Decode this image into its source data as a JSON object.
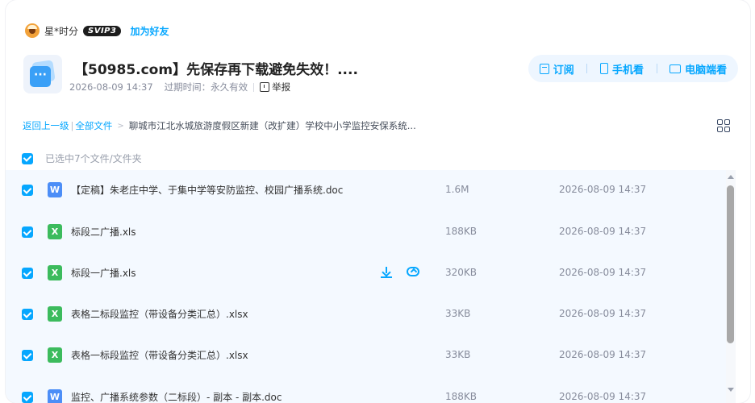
{
  "user": {
    "name": "星*时分",
    "badge": "SVIP3",
    "add_friend": "加为好友"
  },
  "file": {
    "icon_glyph": "···",
    "title": "【50985.com】先保存再下载避免失效！....",
    "date": "2026-08-09 14:37",
    "expire": "过期时间：永久有效",
    "report": "举报"
  },
  "actions": {
    "subscribe": "订阅",
    "mobile": "手机看",
    "pc": "电脑端看"
  },
  "breadcrumb": {
    "back": "返回上一级",
    "all": "全部文件",
    "current": "聊城市江北水城旅游度假区新建（改扩建）学校中小学监控安保系统..."
  },
  "selection": {
    "text": "已选中7个文件/文件夹"
  },
  "files": [
    {
      "type": "W",
      "name": "【定稿】朱老庄中学、于集中学等安防监控、校园广播系统.doc",
      "size": "1.6M",
      "date": "2026-08-09 14:37"
    },
    {
      "type": "X",
      "name": "标段二广播.xls",
      "size": "188KB",
      "date": "2026-08-09 14:37"
    },
    {
      "type": "X",
      "name": "标段一广播.xls",
      "size": "320KB",
      "date": "2026-08-09 14:37"
    },
    {
      "type": "X",
      "name": "表格二标段监控（带设备分类汇总）.xlsx",
      "size": "33KB",
      "date": "2026-08-09 14:37"
    },
    {
      "type": "X",
      "name": "表格一标段监控（带设备分类汇总）.xlsx",
      "size": "33KB",
      "date": "2026-08-09 14:37"
    },
    {
      "type": "W",
      "name": "监控、广播系统参数（二标段）- 副本 - 副本.doc",
      "size": "188KB",
      "date": "2026-08-09 14:37"
    }
  ],
  "colors": {
    "accent": "#06a7ff",
    "list_bg": "#f4f9ff",
    "word": "#4c8ef7",
    "excel": "#3cbb5d"
  }
}
